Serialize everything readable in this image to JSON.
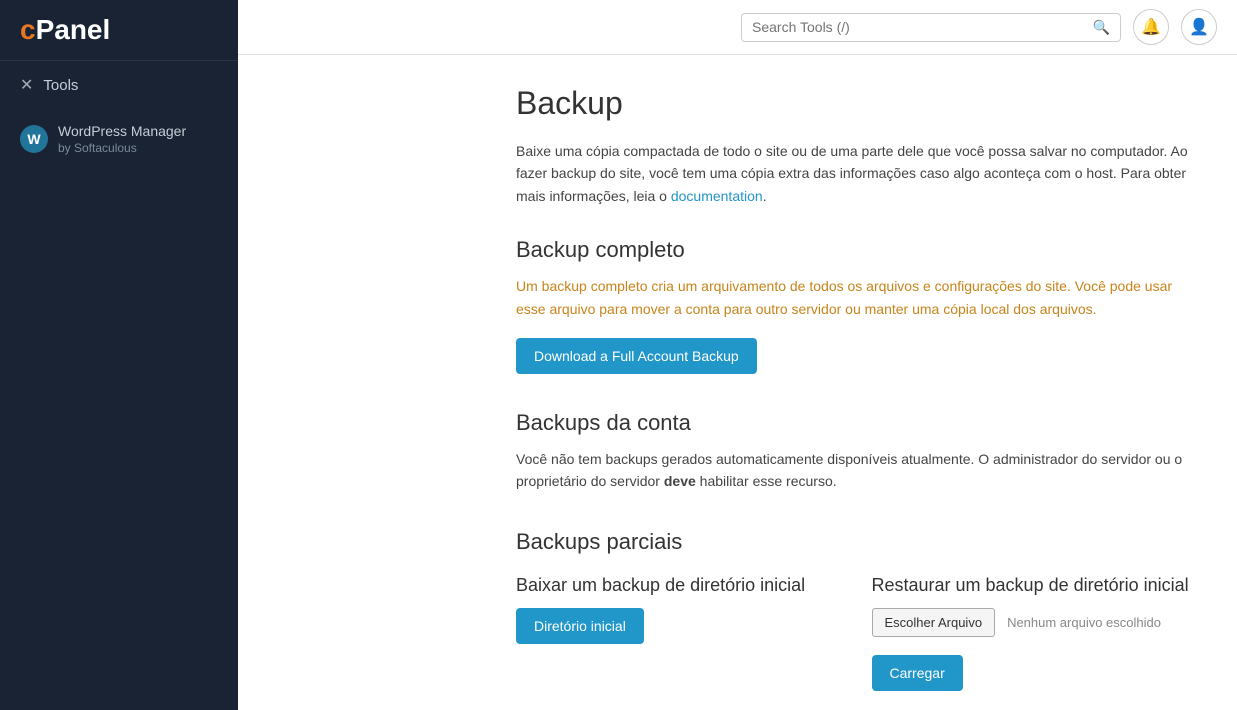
{
  "sidebar": {
    "logo": "cPanel",
    "logo_c": "c",
    "logo_panel": "Panel",
    "nav_items": [
      {
        "id": "tools",
        "label": "Tools",
        "icon": "✕"
      }
    ],
    "wp_item": {
      "title": "WordPress Manager",
      "subtitle": "by Softaculous",
      "logo_letter": "W"
    }
  },
  "header": {
    "search_placeholder": "Search Tools (/)",
    "search_icon": "🔍",
    "bell_icon": "🔔",
    "user_icon": "👤"
  },
  "main": {
    "page_title": "Backup",
    "intro_text": "Baixe uma cópia compactada de todo o site ou de uma parte dele que você possa salvar no computador. Ao fazer backup do site, você tem uma cópia extra das informações caso algo aconteça com o host. Para obter mais informações, leia o ",
    "doc_link_text": "documentation",
    "doc_link_end": ".",
    "backup_completo": {
      "title": "Backup completo",
      "desc": "Um backup completo cria um arquivamento de todos os arquivos e configurações do site. Você pode usar esse arquivo para mover a conta para outro servidor ou manter uma cópia local dos arquivos.",
      "button_label": "Download a Full Account Backup"
    },
    "backups_conta": {
      "title": "Backups da conta",
      "text_start": "Você não tem backups gerados automaticamente disponíveis atualmente. O administrador do servidor ou o proprietário do servidor ",
      "text_bold": "deve",
      "text_end": " habilitar esse recurso."
    },
    "backups_parciais": {
      "title": "Backups parciais",
      "baixar": {
        "title": "Baixar um backup de diretório inicial",
        "button_label": "Diretório inicial"
      },
      "restaurar": {
        "title": "Restaurar um backup de diretório inicial",
        "choose_label": "Escolher Arquivo",
        "no_file_label": "Nenhum arquivo escolhido",
        "upload_label": "Carregar"
      }
    }
  }
}
